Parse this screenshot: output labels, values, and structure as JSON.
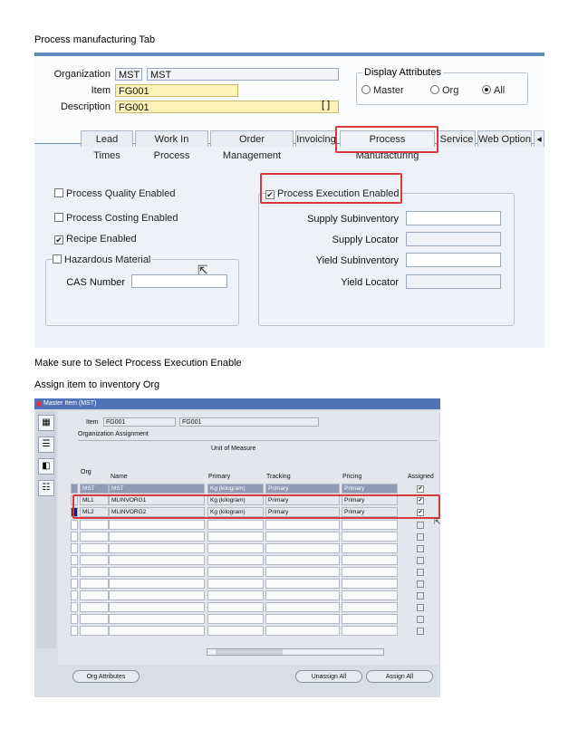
{
  "doc": {
    "heading1": "Process manufacturing Tab",
    "caption1": "Make sure to Select Process Execution Enable",
    "caption2": "Assign item to inventory Org"
  },
  "shot1": {
    "organization_label": "Organization",
    "organization_code": "MST",
    "organization_name": "MST",
    "item_label": "Item",
    "item_value": "FG001",
    "description_label": "Description",
    "description_value": "FG001",
    "bracket_text": "[ ]",
    "display_attributes_title": "Display Attributes",
    "radio_master": "Master",
    "radio_org": "Org",
    "radio_all": "All",
    "tabs": {
      "lead_times": "Lead Times",
      "work_in_process": "Work In Process",
      "order_management": "Order Management",
      "invoicing": "Invoicing",
      "process_manufacturing": "Process Manufacturing",
      "service": "Service",
      "web_option": "Web Option",
      "scroll": "◂"
    },
    "process_quality_enabled": "Process Quality Enabled",
    "process_costing_enabled": "Process Costing Enabled",
    "recipe_enabled": "Recipe Enabled",
    "hazardous_material": "Hazardous Material",
    "cas_number": "CAS Number",
    "process_execution_enabled": "Process Execution Enabled",
    "supply_subinventory": "Supply Subinventory",
    "supply_locator": "Supply Locator",
    "yield_subinventory": "Yield Subinventory",
    "yield_locator": "Yield Locator",
    "check_mark": "✔"
  },
  "shot2": {
    "window_title": "Master Item (MST)",
    "item_label": "Item",
    "item_code": "FG001",
    "item_desc": "FG001",
    "org_assignment": "Organization Assignment",
    "unit_of_measure": "Unit of Measure",
    "col_org": "Org",
    "col_name": "Name",
    "col_primary": "Primary",
    "col_tracking": "Tracking",
    "col_pricing": "Pricing",
    "col_assigned": "Assigned",
    "rows": [
      {
        "org": "MST",
        "name": "MST",
        "primary": "Kg (kilogram)",
        "tracking": "Primary",
        "pricing": "Primary",
        "assigned": "✔"
      },
      {
        "org": "ML1",
        "name": "MLINVORG1",
        "primary": "Kg (kilogram)",
        "tracking": "Primary",
        "pricing": "Primary",
        "assigned": "✔"
      },
      {
        "org": "ML2",
        "name": "MLINVORG2",
        "primary": "Kg (kilogram)",
        "tracking": "Primary",
        "pricing": "Primary",
        "assigned": "✔"
      }
    ],
    "btn_org_attributes": "Org Attributes",
    "btn_unassign_all": "Unassign All",
    "btn_assign_all": "Assign All"
  }
}
